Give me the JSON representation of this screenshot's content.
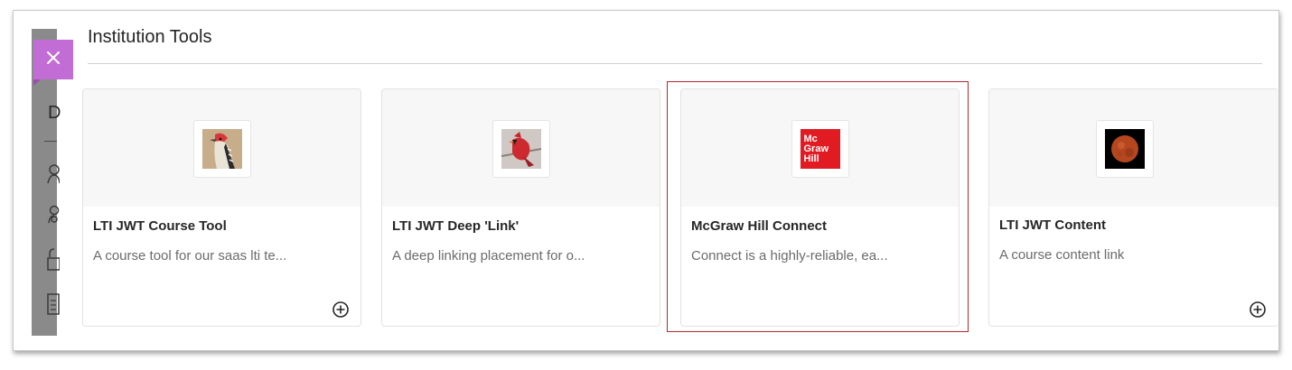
{
  "panel": {
    "title": "Institution Tools",
    "close_icon": "close-icon"
  },
  "sidebar_peek": {
    "letter": "D",
    "icons": [
      "user-icon",
      "users-icon",
      "lock-icon",
      "document-icon"
    ]
  },
  "tools": [
    {
      "name": "LTI JWT Course Tool",
      "description": "A course tool for our saas lti te...",
      "thumbnail": "woodpecker-image",
      "has_add_button": true
    },
    {
      "name": "LTI JWT Deep 'Link'",
      "description": "A deep linking placement for o...",
      "thumbnail": "cardinal-image",
      "has_add_button": false
    },
    {
      "name": "McGraw Hill Connect",
      "description": "Connect is a highly-reliable, ea...",
      "thumbnail": "mcgraw-hill-logo",
      "logo_text": [
        "Mc",
        "Graw",
        "Hill"
      ],
      "highlighted": true,
      "has_add_button": false
    },
    {
      "name": "LTI JWT Content",
      "description": "A course content link",
      "thumbnail": "moon-image",
      "has_add_button": true
    }
  ],
  "colors": {
    "accent_purple": "#c26dd6",
    "highlight_red": "#b0282e",
    "mcgraw_red": "#e21b23"
  }
}
